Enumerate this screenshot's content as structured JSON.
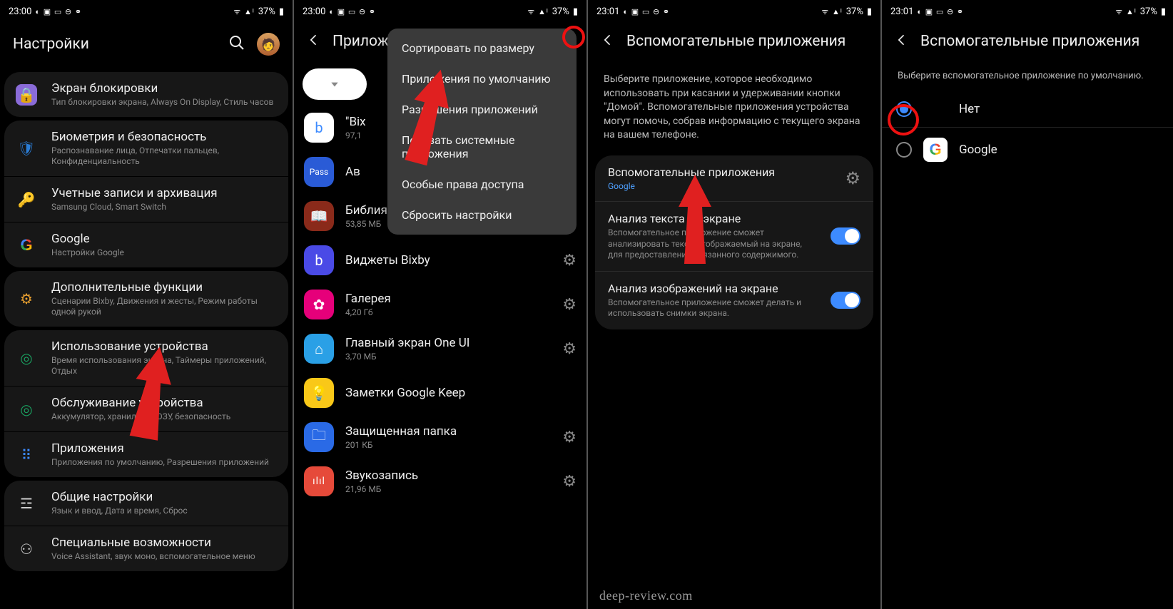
{
  "status": {
    "time1": "23:00",
    "time2": "23:01",
    "battery": "37%",
    "iconsLeft": "◐ ▣ ▭ ⊖ ⚭",
    "iconsRight": "ᯤ ▲ᴵ"
  },
  "sc1": {
    "title": "Настройки",
    "items": [
      {
        "icon": "🔒",
        "bg": "#8a6bd8",
        "label": "Экран блокировки",
        "sub": "Тип блокировки экрана, Always On Display, Стиль часов"
      },
      {
        "icon": "🛡",
        "bg": "#2a7dd6",
        "label": "Биометрия и безопасность",
        "sub": "Распознавание лица, Отпечатки пальцев, Конфиденциальность"
      },
      {
        "icon": "🔑",
        "bg": "#d9a020",
        "label": "Учетные записи и архивация",
        "sub": "Samsung Cloud, Smart Switch"
      },
      {
        "icon": "G",
        "bg": "transparent",
        "label": "Google",
        "sub": "Настройки Google"
      },
      {
        "icon": "⚙",
        "bg": "#e9a030",
        "label": "Дополнительные функции",
        "sub": "Сценарии Bixby, Движения и жесты, Режим работы одной рукой"
      },
      {
        "icon": "◎",
        "bg": "#1aa060",
        "label": "Использование устройства",
        "sub": "Время использования экрана, Таймеры приложений, Отдых"
      },
      {
        "icon": "◎",
        "bg": "#1aa060",
        "label": "Обслуживание устройства",
        "sub": "Аккумулятор, хранилище, ОЗУ, безопасность"
      },
      {
        "icon": "▦",
        "bg": "#3d8bff",
        "label": "Приложения",
        "sub": "Приложения по умолчанию, Разрешения приложений"
      },
      {
        "icon": "☰",
        "bg": "#888",
        "label": "Общие настройки",
        "sub": "Язык и ввод, Дата и время, Сброс"
      },
      {
        "icon": "⚇",
        "bg": "#888",
        "label": "Специальные возможности",
        "sub": "Voice Assistant, звук моно, вспомогательное меню"
      }
    ]
  },
  "sc2": {
    "title": "Прилож",
    "menu": [
      "Сортировать по размеру",
      "Приложения по умолчанию",
      "Разрешения приложений",
      "Показать системные приложения",
      "Особые права доступа",
      "Сбросить настройки"
    ],
    "apps": [
      {
        "name": "\"Bix",
        "size": "97,1",
        "bg": "#fff",
        "fg": "#3d8bff",
        "glyph": "b"
      },
      {
        "name": "Ав",
        "size": "",
        "bg": "#2a5bd6",
        "fg": "#fff",
        "glyph": "Pass"
      },
      {
        "name": "Библия",
        "size": "53,85 МБ",
        "bg": "#8a2a1a",
        "fg": "#e0c080",
        "glyph": "📖"
      },
      {
        "name": "Виджеты Bixby",
        "size": "",
        "bg": "#4a4ae6",
        "fg": "#fff",
        "glyph": "b",
        "gear": true
      },
      {
        "name": "Галерея",
        "size": "4,20 Гб",
        "bg": "#e6007a",
        "fg": "#fff",
        "glyph": "✿",
        "gear": true
      },
      {
        "name": "Главный экран One UI",
        "size": "3,70 МБ",
        "bg": "#2aa0e6",
        "fg": "#fff",
        "glyph": "⌂",
        "gear": true
      },
      {
        "name": "Заметки Google Keep",
        "size": "",
        "bg": "#f9c818",
        "fg": "#fff",
        "glyph": "💡"
      },
      {
        "name": "Защищенная папка",
        "size": "201 КБ",
        "bg": "#2a6ae6",
        "fg": "#fff",
        "glyph": "🗀",
        "gear": true
      },
      {
        "name": "Звукозапись",
        "size": "21,96 МБ",
        "bg": "#e64a3a",
        "fg": "#fff",
        "glyph": "|||",
        "gear": true
      }
    ]
  },
  "sc3": {
    "title": "Вспомогательные приложения",
    "desc": "Выберите приложение, которое необходимо использовать при касании и удерживании кнопки \"Домой\". Вспомогательные приложения устройства могут помочь, собрав информацию с текущего экрана на вашем телефоне.",
    "row1": {
      "label": "Вспомогательные приложения",
      "link": "Google"
    },
    "row2": {
      "label": "Анализ текста на экране",
      "sub": "Вспомогательное приложение сможет анализировать текст, отображаемый на экране, для предоставления связанного содержимого."
    },
    "row3": {
      "label": "Анализ изображений на экране",
      "sub": "Вспомогательное приложение сможет делать и использовать снимки экрана."
    },
    "watermark": "deep-review.com"
  },
  "sc4": {
    "title": "Вспомогательные приложения",
    "desc": "Выберите вспомогательное приложение по умолчанию.",
    "opt1": "Нет",
    "opt2": "Google"
  }
}
